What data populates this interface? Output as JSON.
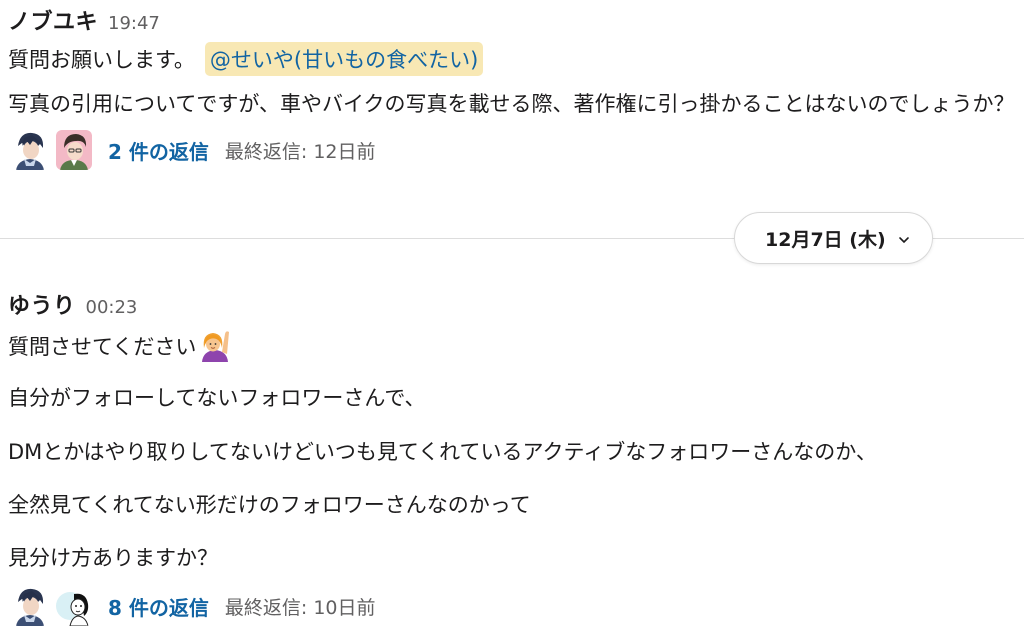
{
  "messages": [
    {
      "author": "ノブユキ",
      "time": "19:47",
      "line1_text": "質問お願いします。",
      "mention": "@せいや(甘いもの食べたい)",
      "line2": "写真の引用についてですが、車やバイクの写真を載せる際、著作権に引っ掛かることはないのでしょうか？",
      "thread": {
        "replies": "2 件の返信",
        "last_reply": "最終返信: 12日前"
      }
    },
    {
      "author": "ゆうり",
      "time": "00:23",
      "line1_text": "質問させてください",
      "emoji": "raising-hand-emoji",
      "line2": "自分がフォローしてないフォロワーさんで、",
      "line3": "DMとかはやり取りしてないけどいつも見てくれているアクティブなフォロワーさんなのか、",
      "line4": "全然見てくれてない形だけのフォロワーさんなのかって",
      "line5": "見分け方ありますか？",
      "thread": {
        "replies": "8 件の返信",
        "last_reply": "最終返信: 10日前"
      }
    }
  ],
  "date_divider": {
    "label": "12月7日 (木)",
    "icon": "chevron-down-icon"
  },
  "colors": {
    "link": "#1264a3",
    "mention_bg": "#f8e8b4",
    "muted": "#616061"
  }
}
